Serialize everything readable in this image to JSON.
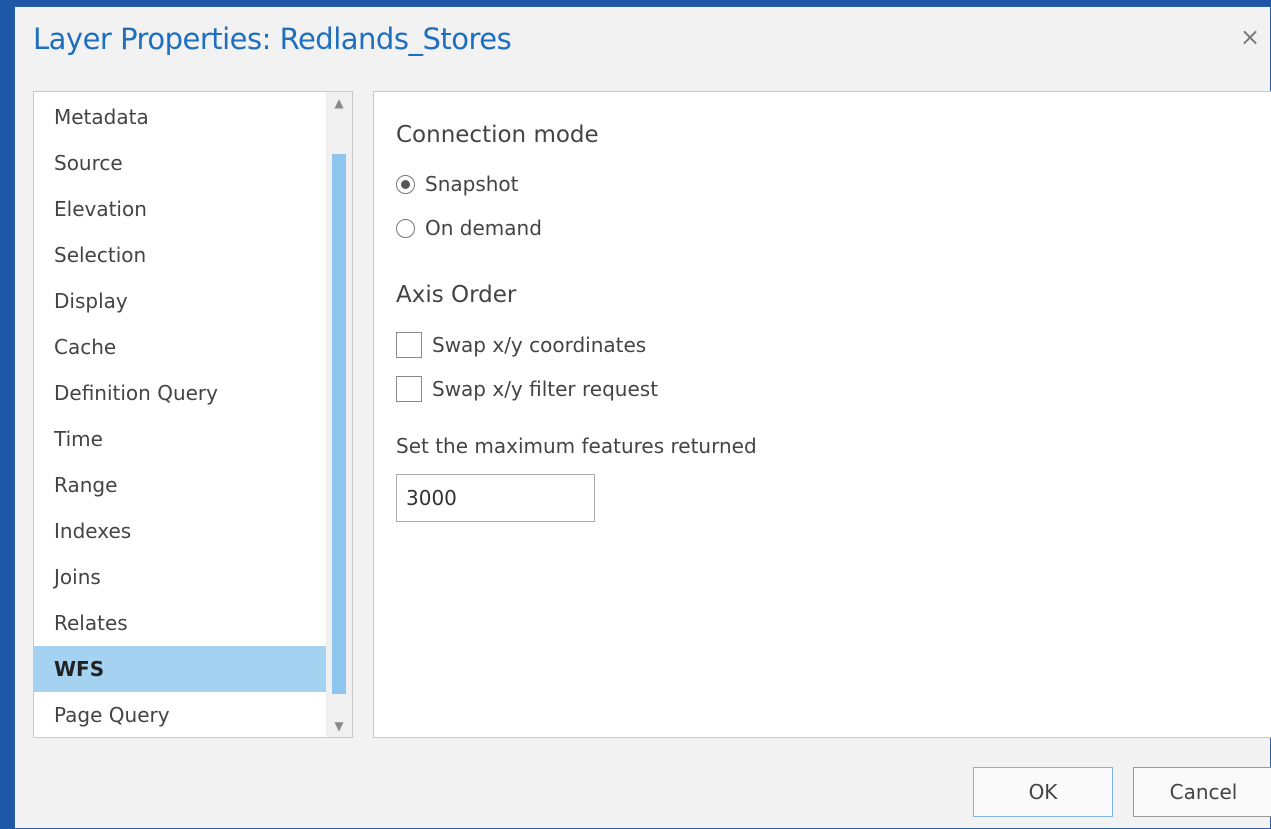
{
  "dialog": {
    "title": "Layer Properties: Redlands_Stores",
    "close_glyph": "×"
  },
  "nav": {
    "items": [
      {
        "label": "Metadata"
      },
      {
        "label": "Source"
      },
      {
        "label": "Elevation"
      },
      {
        "label": "Selection"
      },
      {
        "label": "Display"
      },
      {
        "label": "Cache"
      },
      {
        "label": "Definition Query"
      },
      {
        "label": "Time"
      },
      {
        "label": "Range"
      },
      {
        "label": "Indexes"
      },
      {
        "label": "Joins"
      },
      {
        "label": "Relates"
      },
      {
        "label": "WFS"
      },
      {
        "label": "Page Query"
      }
    ],
    "selected": "WFS"
  },
  "panel": {
    "connection_mode": {
      "heading": "Connection mode",
      "options": [
        {
          "label": "Snapshot",
          "checked": true
        },
        {
          "label": "On demand",
          "checked": false
        }
      ]
    },
    "axis_order": {
      "heading": "Axis Order",
      "options": [
        {
          "label": "Swap x/y coordinates",
          "checked": false
        },
        {
          "label": "Swap x/y filter request",
          "checked": false
        }
      ]
    },
    "max_features": {
      "label": "Set the maximum features returned",
      "value": "3000"
    }
  },
  "buttons": {
    "ok": "OK",
    "cancel": "Cancel"
  },
  "colors": {
    "accent": "#1f6fbf",
    "selection": "#a6d2f2",
    "window_frame": "#1e56a8"
  }
}
